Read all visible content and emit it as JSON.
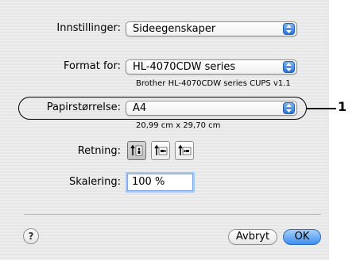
{
  "settings_label": "Innstillinger:",
  "settings_value": "Sideegenskaper",
  "format_label": "Format for:",
  "format_value": "HL-4070CDW series",
  "format_description": "Brother HL-4070CDW series CUPS v1.1",
  "paper_label": "Papirstørrelse:",
  "paper_value": "A4",
  "paper_dimensions": "20,99 cm x 29,70 cm",
  "callout_number": "1",
  "orientation_label": "Retning:",
  "orientation_options": [
    "portrait-icon",
    "landscape-left-icon",
    "landscape-right-icon"
  ],
  "orientation_selected": "portrait-icon",
  "scaling_label": "Skalering:",
  "scaling_value": "100 %",
  "help_label": "?",
  "cancel_label": "Avbryt",
  "ok_label": "OK",
  "colors": {
    "accent": "#3e8ef0",
    "dialog_bg": "#e8e8e8",
    "focus_ring": "#a9c9f2"
  }
}
